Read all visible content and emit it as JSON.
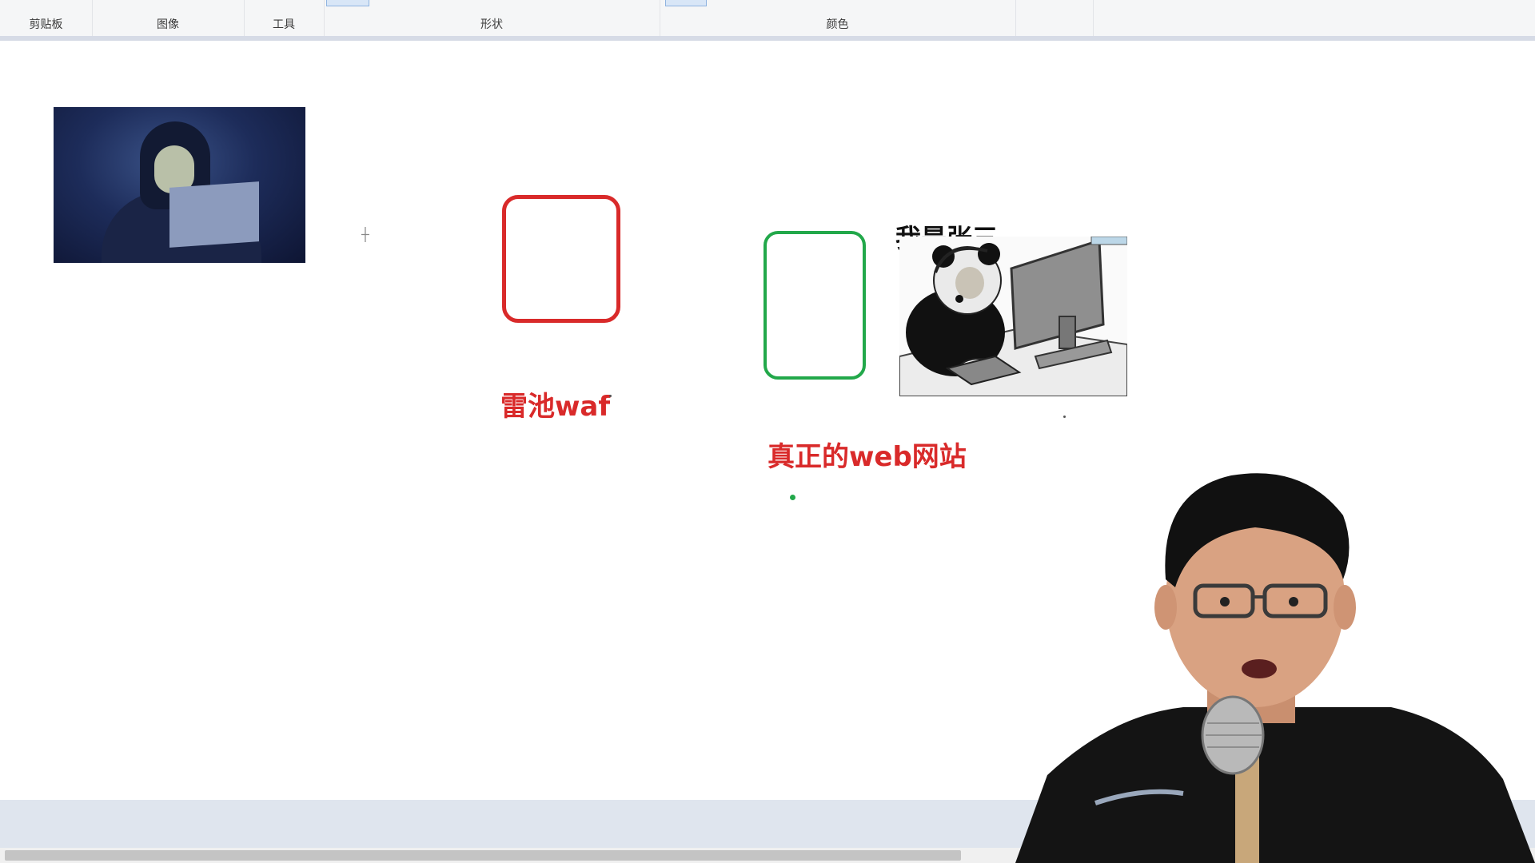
{
  "ribbon": {
    "groups": [
      {
        "label": "剪贴板"
      },
      {
        "label": "图像"
      },
      {
        "label": "工具"
      },
      {
        "label": "形状"
      },
      {
        "label": "颜色"
      }
    ]
  },
  "canvas": {
    "waf_label": "雷池waf",
    "web_label": "真正的web网站",
    "meme_caption": "我是张三"
  },
  "colors": {
    "red": "#d92a2a",
    "green": "#22a84a",
    "ribbon_bg": "#f5f6f7"
  },
  "icons": [
    "crosshair-cursor-icon",
    "scroll-right-arrow-icon"
  ]
}
